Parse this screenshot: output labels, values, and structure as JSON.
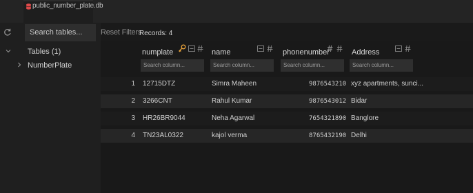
{
  "file": {
    "name": "public_number_plate.db",
    "icon": "database-icon",
    "icon_color": "#e04a4a"
  },
  "sidebar": {
    "search_placeholder": "Search tables...",
    "tables_label": "Tables (1)",
    "tables": [
      "NumberPlate"
    ]
  },
  "toolbar": {
    "reset_label": "Reset Filters",
    "records_label": "Records: 4"
  },
  "columns": [
    {
      "name": "numplate",
      "search_placeholder": "Search column..."
    },
    {
      "name": "name",
      "search_placeholder": "Search column..."
    },
    {
      "name": "phonenumber",
      "search_placeholder": "Search column..."
    },
    {
      "name": "Address",
      "search_placeholder": "Search column..."
    }
  ],
  "rows": [
    {
      "num": "1",
      "numplate": "12715DTZ",
      "name": "Simra Maheen",
      "phonenumber": "9876543210",
      "address": "xyz apartments, sunci..."
    },
    {
      "num": "2",
      "numplate": "3266CNT",
      "name": "Rahul Kumar",
      "phonenumber": "9876543012",
      "address": "Bidar"
    },
    {
      "num": "3",
      "numplate": "HR26BR9044",
      "name": "Neha Agarwal",
      "phonenumber": "7654321890",
      "address": "Banglore"
    },
    {
      "num": "4",
      "numplate": "TN23AL0322",
      "name": "kajol verma",
      "phonenumber": "8765432190",
      "address": "Delhi"
    }
  ],
  "colors": {
    "key_icon": "#e8a23a",
    "background": "#1a1a1a",
    "sidebar": "#1f1f1f"
  }
}
